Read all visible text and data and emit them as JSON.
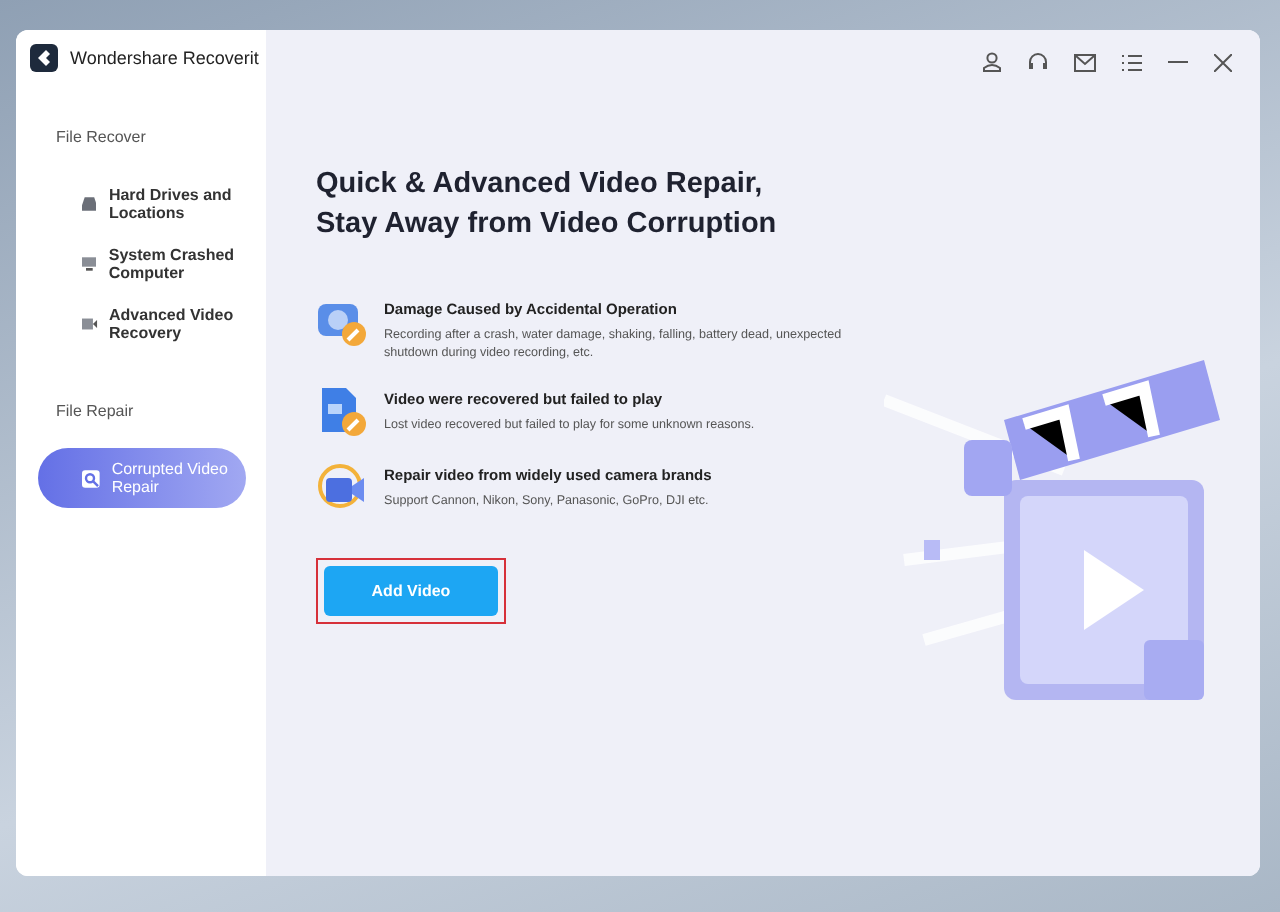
{
  "window": {
    "title": "Wondershare Recoverit"
  },
  "sidebar": {
    "sections": [
      {
        "heading": "File Recover",
        "items": [
          {
            "label": "Hard Drives and Locations",
            "kind": "drive",
            "selected": false
          },
          {
            "label": "System Crashed Computer",
            "kind": "monitor",
            "selected": false
          },
          {
            "label": "Advanced Video Recovery",
            "kind": "camera",
            "selected": false
          }
        ]
      },
      {
        "heading": "File Repair",
        "items": [
          {
            "label": "Corrupted Video Repair",
            "kind": "repair",
            "selected": true
          }
        ]
      }
    ]
  },
  "main": {
    "headline": [
      "Quick & Advanced Video Repair,",
      "Stay Away from Video Corruption"
    ],
    "features": [
      {
        "kind": "camera",
        "title": "Damage Caused by Accidental Operation",
        "text": "Recording after a crash, water damage, shaking, falling, battery dead, unexpected shutdown during video recording, etc."
      },
      {
        "kind": "file",
        "title": "Video were recovered but failed to play",
        "text": "Lost video recovered but failed to play for some unknown reasons."
      },
      {
        "kind": "brands",
        "title": "Repair video from widely used camera brands",
        "text": "Support Cannon, Nikon, Sony, Panasonic, GoPro, DJI etc."
      }
    ],
    "button": {
      "label": "Add Video",
      "highlighted": true
    }
  }
}
